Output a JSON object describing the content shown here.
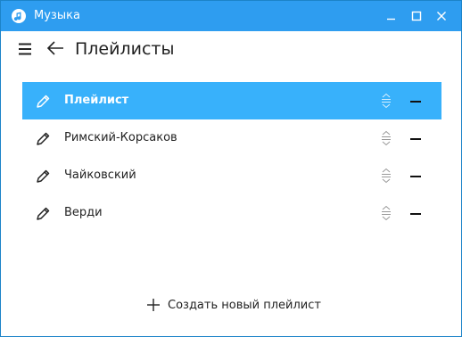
{
  "window": {
    "title": "Музыка",
    "app_icon": "music-note-icon"
  },
  "titlebar_buttons": [
    "minimize-icon",
    "maximize-icon",
    "close-icon"
  ],
  "toolbar": {
    "title": "Плейлисты",
    "menu_icon": "hamburger-menu-icon",
    "back_icon": "back-arrow-icon"
  },
  "playlists": [
    {
      "name": "Плейлист",
      "selected": true
    },
    {
      "name": "Римский-Корсаков",
      "selected": false
    },
    {
      "name": "Чайковский",
      "selected": false
    },
    {
      "name": "Верди",
      "selected": false
    }
  ],
  "create_playlist": {
    "label": "Создать новый плейлист",
    "icon": "plus-icon"
  },
  "colors": {
    "titlebar": "#2e9df0",
    "selection": "#38b1fb",
    "border": "#1c83c9"
  }
}
